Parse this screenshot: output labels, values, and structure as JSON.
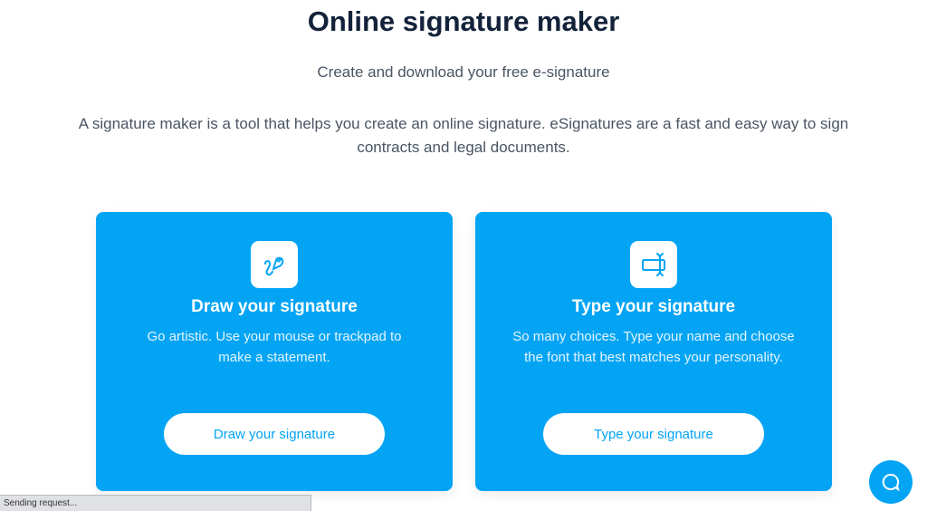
{
  "header": {
    "title": "Online signature maker",
    "subtitle": "Create and download your free e-signature",
    "description": "A signature maker is a tool that helps you create an online signature. eSignatures are a fast and easy way to sign contracts and legal documents."
  },
  "cards": [
    {
      "icon": "pen-draw-icon",
      "title": "Draw your signature",
      "text": "Go artistic. Use your mouse or trackpad to make a statement.",
      "button": "Draw your signature"
    },
    {
      "icon": "text-cursor-icon",
      "title": "Type your signature",
      "text": "So many choices. Type your name and choose the font that best matches your personality.",
      "button": "Type your signature"
    }
  ],
  "chat": {
    "icon": "chat-bubble-icon"
  },
  "status_bar": {
    "text": "Sending request..."
  },
  "colors": {
    "accent": "#03a4f4",
    "title": "#13223a",
    "body_text": "#4a5563"
  }
}
